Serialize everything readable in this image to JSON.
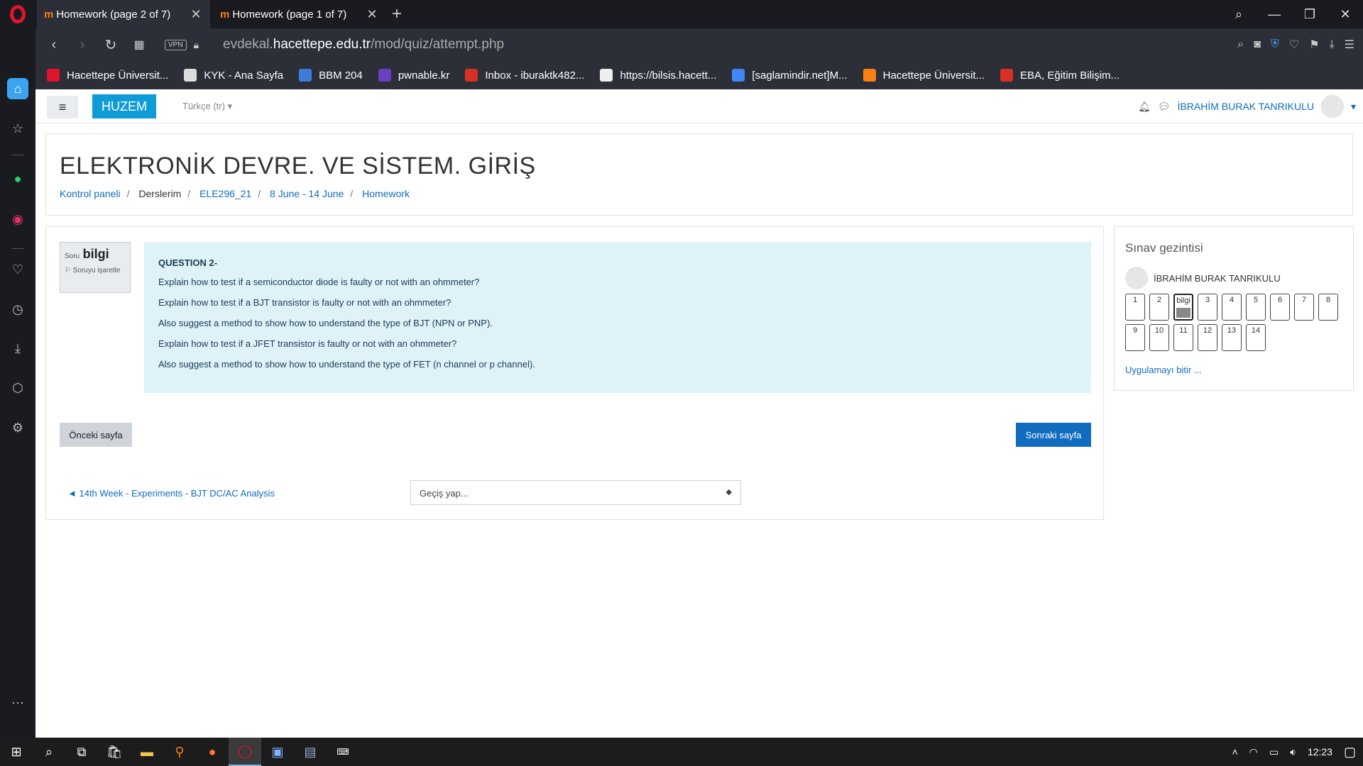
{
  "browser": {
    "tabs": [
      {
        "title": "Homework (page 2 of 7)",
        "active": true
      },
      {
        "title": "Homework (page 1 of 7)",
        "active": false
      }
    ],
    "url_prefix": "evdekal.",
    "url_domain": "hacettepe.edu.tr",
    "url_path": "/mod/quiz/attempt.php",
    "vpn_label": "VPN",
    "bookmarks": [
      {
        "label": "Hacettepe Üniversit...",
        "icon_color": "#e0142c"
      },
      {
        "label": "KYK - Ana Sayfa",
        "icon_color": "#dddddd"
      },
      {
        "label": "BBM 204",
        "icon_color": "#3b7dd8"
      },
      {
        "label": "pwnable.kr",
        "icon_color": "#6a3fc0"
      },
      {
        "label": "Inbox - iburaktk482...",
        "icon_color": "#d93025"
      },
      {
        "label": "https://bilsis.hacett...",
        "icon_color": "#eeeeee"
      },
      {
        "label": "[saglamindir.net]M...",
        "icon_color": "#4285f4"
      },
      {
        "label": "Hacettepe Üniversit...",
        "icon_color": "#f98012"
      },
      {
        "label": "EBA, Eğitim Bilişim...",
        "icon_color": "#d93025"
      }
    ]
  },
  "site": {
    "brand": "HUZEM",
    "language": "Türkçe (tr)",
    "user_name": "İBRAHİM BURAK TANRIKULU"
  },
  "course": {
    "title": "ELEKTRONİK DEVRE. VE SİSTEM. GİRİŞ",
    "breadcrumbs": [
      "Kontrol paneli",
      "Derslerim",
      "ELE296_21",
      "8 June - 14 June",
      "Homework"
    ]
  },
  "question": {
    "info_label": "Soru",
    "info_number": "bilgi",
    "flag_label": "Soruyu işaretle",
    "heading": "QUESTION 2-",
    "lines": [
      "Explain how to test if a semiconductor diode is faulty or not with an ohmmeter?",
      "Explain how to test if a BJT transistor is faulty or not with an ohmmeter?",
      "Also suggest a method to show how to understand the type of BJT (NPN or PNP).",
      "Explain how to test if a JFET transistor is faulty or not with an ohmmeter?",
      "Also suggest a method to show how to understand the type of FET (n channel or p channel)."
    ]
  },
  "pager": {
    "prev": "Önceki sayfa",
    "next": "Sonraki sayfa"
  },
  "footer_nav": {
    "prev_activity": "◄ 14th Week - Experiments - BJT DC/AC Analysis",
    "jump_placeholder": "Geçiş yap..."
  },
  "quiz_nav": {
    "title": "Sınav gezintisi",
    "user": "İBRAHİM BURAK TANRIKULU",
    "row1": [
      "1",
      "2",
      "bilgi",
      "3",
      "4",
      "5",
      "6",
      "7",
      "8"
    ],
    "row2": [
      "9",
      "10",
      "11",
      "12",
      "13",
      "14"
    ],
    "finish": "Uygulamayı bitir ..."
  },
  "taskbar": {
    "time": "12:23"
  }
}
